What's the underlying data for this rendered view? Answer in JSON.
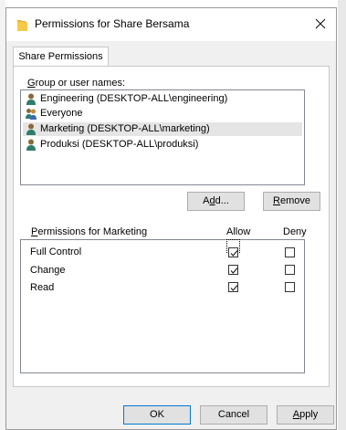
{
  "dialog": {
    "title": "Permissions for Share Bersama",
    "close_glyph": "✕",
    "tab_label": "Share Permissions"
  },
  "users": {
    "label": "Group or user names:",
    "items": [
      {
        "label": "Engineering (DESKTOP-ALL\\engineering)",
        "icon": "user-icon",
        "selected": false
      },
      {
        "label": "Everyone",
        "icon": "group-icon",
        "selected": false
      },
      {
        "label": "Marketing (DESKTOP-ALL\\marketing)",
        "icon": "user-icon",
        "selected": true
      },
      {
        "label": "Produksi (DESKTOP-ALL\\produksi)",
        "icon": "user-icon",
        "selected": false
      }
    ],
    "add_label": "Add...",
    "remove_label": "Remove"
  },
  "permissions": {
    "label": "Permissions for Marketing",
    "allow_header": "Allow",
    "deny_header": "Deny",
    "rows": [
      {
        "name": "Full Control",
        "allow": true,
        "deny": false
      },
      {
        "name": "Change",
        "allow": true,
        "deny": false
      },
      {
        "name": "Read",
        "allow": true,
        "deny": false
      }
    ]
  },
  "footer": {
    "ok_label": "OK",
    "cancel_label": "Cancel",
    "apply_label": "Apply"
  },
  "colors": {
    "dialog_bg": "#f0f0f0",
    "selection_bg": "#e5e5e5",
    "default_button_border": "#0078d7",
    "folder_icon": "#f7c948"
  }
}
